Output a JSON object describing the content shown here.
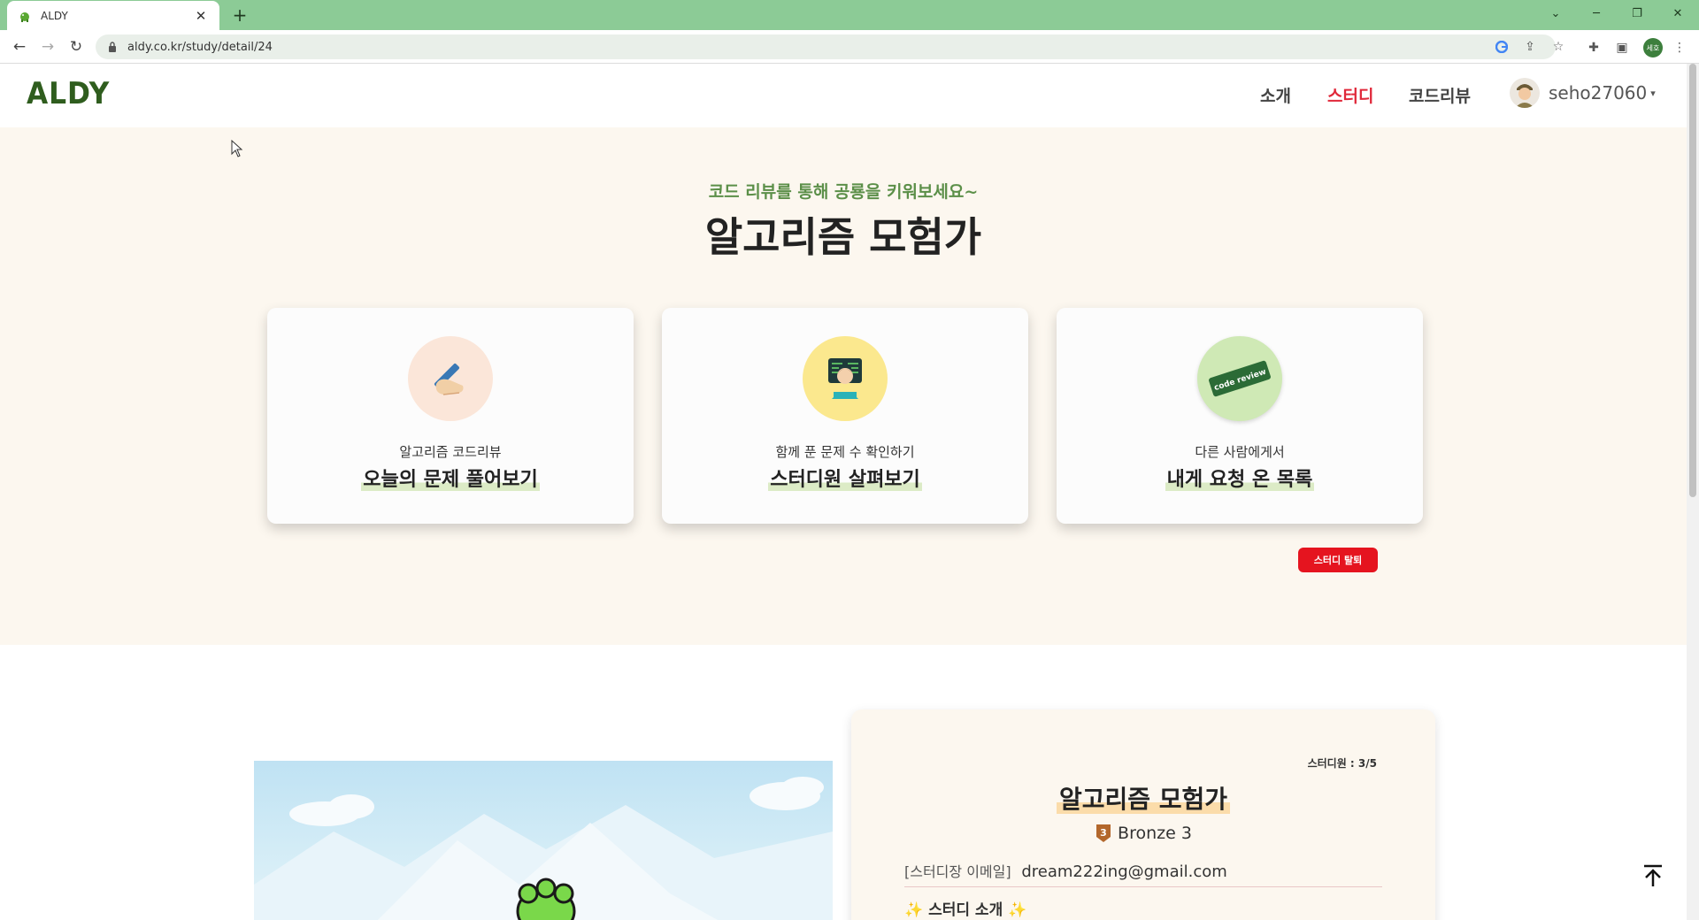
{
  "browser": {
    "tab_title": "ALDY",
    "tab_close": "✕",
    "new_tab": "+",
    "url": "aldy.co.kr/study/detail/24",
    "profile_initials": "세호"
  },
  "header": {
    "logo": "ALDY",
    "nav": [
      "소개",
      "스터디",
      "코드리뷰"
    ],
    "username": "seho27060",
    "caret": "▾"
  },
  "hero": {
    "subtitle": "코드 리뷰를 통해 공룡을 키워보세요~",
    "title": "알고리즘 모험가",
    "cards": [
      {
        "small": "알고리즘 코드리뷰",
        "big": "오늘의 문제 풀어보기",
        "icon": "writing-hand-icon"
      },
      {
        "small": "함께 푼 문제 수 확인하기",
        "big": "스터디원 살펴보기",
        "icon": "developer-icon"
      },
      {
        "small": "다른 사람에게서",
        "big": "내게 요청 온 목록",
        "icon": "code-review-icon"
      }
    ],
    "quit_button": "스터디 탈퇴",
    "code_review_badge": "code review"
  },
  "study": {
    "members": "스터디원 : 3/5",
    "title": "알고리즘 모험가",
    "tier_number": "3",
    "tier": "Bronze 3",
    "email_label": "[스터디장 이메일]",
    "email": "dream222ing@gmail.com",
    "intro_heading": "✨ 스터디 소개 ✨"
  },
  "colors": {
    "tab_bar": "#8ccb96",
    "logo": "#2f5d1e",
    "active_nav": "#e0283a",
    "hero_bg": "#fcf7ef",
    "subtitle": "#5b8f48",
    "quit_button": "#e5141f"
  }
}
